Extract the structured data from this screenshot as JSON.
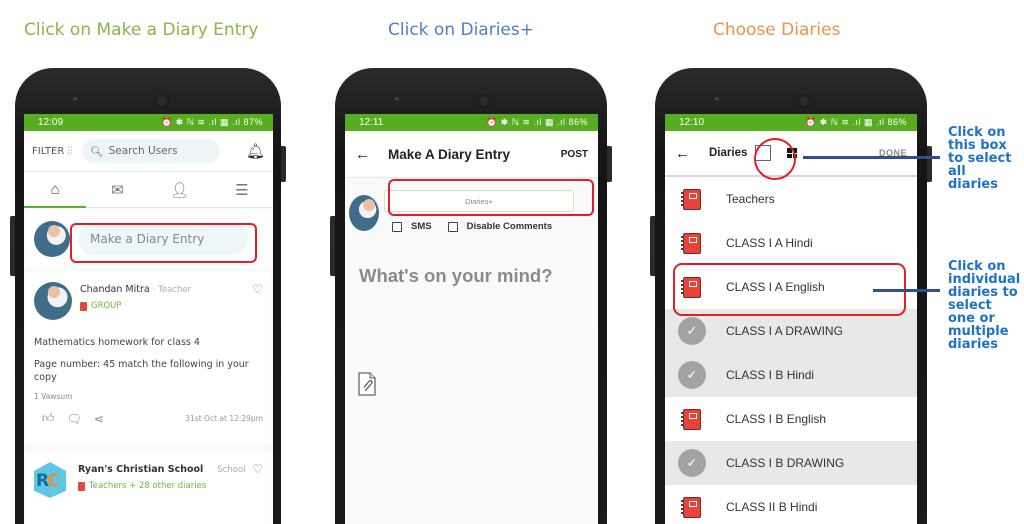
{
  "steps": [
    {
      "title": "Click on Make a Diary Entry",
      "color": "#8fb24b"
    },
    {
      "title": "Click on Diaries+",
      "color": "#4f7fbf"
    },
    {
      "title": "Choose Diaries",
      "color": "#f0914a"
    }
  ],
  "brand_color": "#55ad1f",
  "highlight_color": "#e21f26",
  "phone1": {
    "status": {
      "time": "12:09",
      "icons": "⏰ ✱ ℕ ≋ .ıl ▦ .ıl",
      "battery": "87%"
    },
    "header": {
      "filter_label": "FILTER",
      "search_placeholder": "Search Users"
    },
    "tabs": [
      {
        "icon": "home-icon",
        "active": true
      },
      {
        "icon": "mail-icon",
        "active": false
      },
      {
        "icon": "teacher-icon",
        "active": false
      },
      {
        "icon": "menu-icon",
        "active": false
      }
    ],
    "entry_placeholder": "Make a Diary Entry",
    "post": {
      "author": "Chandan Mitra",
      "role": "Teacher",
      "group": "GROUP",
      "body": [
        "Mathematics homework for class 4",
        "Page number: 45 match the following in your copy"
      ],
      "reactions": "1 Vawsum",
      "time": "31st Oct at 12:29pm"
    },
    "school_post": {
      "logo_text_a": "R",
      "logo_text_b": "C",
      "name": "Ryan's Christian School",
      "role": "School",
      "audience": "Teachers + 28 other diaries"
    }
  },
  "phone2": {
    "status": {
      "time": "12:11",
      "icons": "⏰ ✱ ℕ ≋ .ıl ▦ .ıl",
      "battery": "86%"
    },
    "title": "Make A Diary Entry",
    "post_label": "POST",
    "diaries_field": "Diaries+",
    "options": [
      {
        "label": "SMS",
        "checked": false
      },
      {
        "label": "Disable Comments",
        "checked": false
      }
    ],
    "compose_placeholder": "What's on your mind?"
  },
  "phone3": {
    "status": {
      "time": "12:10",
      "icons": "⏰ ✱ ℕ ≋ .ıl ▦ .ıl",
      "battery": "86%"
    },
    "title": "Diaries",
    "done_label": "DONE",
    "select_all_checked": false,
    "diaries": [
      {
        "name": "Teachers",
        "selected": false
      },
      {
        "name": "CLASS I A Hindi",
        "selected": false
      },
      {
        "name": "CLASS I A English",
        "selected": false
      },
      {
        "name": "CLASS I A DRAWING",
        "selected": true
      },
      {
        "name": "CLASS I B Hindi",
        "selected": true
      },
      {
        "name": "CLASS I B English",
        "selected": false
      },
      {
        "name": "CLASS I B DRAWING",
        "selected": true
      },
      {
        "name": "CLASS II B Hindi",
        "selected": false
      }
    ]
  },
  "annotations": [
    {
      "lines": [
        "Click on",
        "this box",
        "to select",
        "all",
        "diaries"
      ]
    },
    {
      "lines": [
        "Click on",
        "individual",
        "diaries to",
        "select",
        "one or",
        "multiple",
        "diaries"
      ]
    }
  ]
}
